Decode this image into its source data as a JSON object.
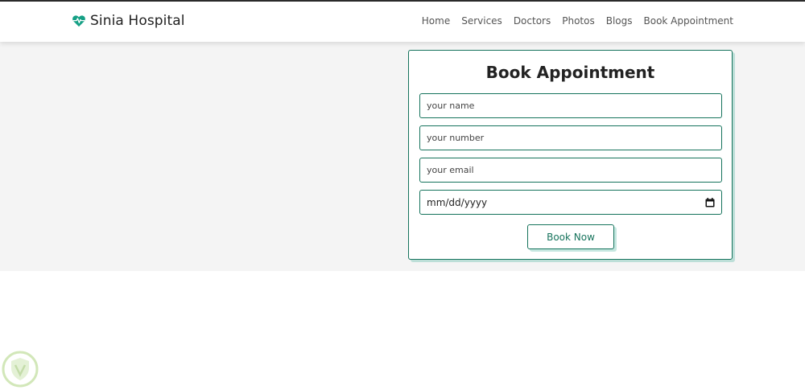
{
  "header": {
    "logo_text": "Sinia Hospital",
    "logo_icon": "heartbeat-icon",
    "nav": [
      {
        "label": "Home"
      },
      {
        "label": "Services"
      },
      {
        "label": "Doctors"
      },
      {
        "label": "Photos"
      },
      {
        "label": "Blogs"
      },
      {
        "label": "Book Appointment"
      }
    ]
  },
  "form": {
    "title": "Book Appointment",
    "name_placeholder": "your name",
    "number_placeholder": "your number",
    "email_placeholder": "your email",
    "date_placeholder": "mm/dd/yyyy",
    "date_icon": "calendar-icon",
    "submit_label": "Book Now"
  },
  "colors": {
    "accent": "#16735c",
    "accent_light": "#16a085",
    "band_background": "#f4f4f4"
  }
}
